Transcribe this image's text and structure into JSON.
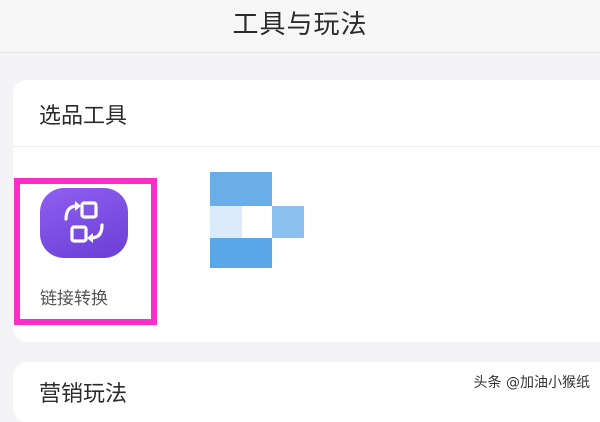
{
  "header": {
    "title": "工具与玩法"
  },
  "tools_section": {
    "title": "选品工具",
    "items": [
      {
        "label": "链接转换",
        "icon": "link-convert-icon",
        "icon_color": "#7a4fe3"
      }
    ],
    "highlight_color": "#ff2ec8"
  },
  "marketing_section": {
    "title": "营销玩法"
  },
  "watermark": {
    "text": "头条 @加油小猴纸"
  }
}
